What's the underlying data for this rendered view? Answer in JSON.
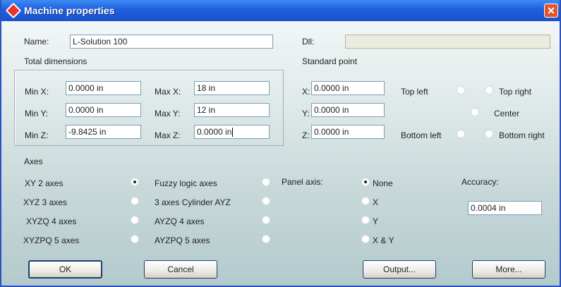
{
  "window": {
    "title": "Machine properties",
    "close_glyph": "✕"
  },
  "name": {
    "label": "Name:",
    "value": "L-Solution 100"
  },
  "dll": {
    "label": "Dll:",
    "value": ""
  },
  "total_dimensions": {
    "title": "Total dimensions",
    "min_x": {
      "label": "Min X:",
      "value": "0.0000 in"
    },
    "max_x": {
      "label": "Max X:",
      "value": "18 in"
    },
    "min_y": {
      "label": "Min Y:",
      "value": "0.0000 in"
    },
    "max_y": {
      "label": "Max Y:",
      "value": "12 in"
    },
    "min_z": {
      "label": "Min Z:",
      "value": "-9.8425 in"
    },
    "max_z": {
      "label": "Max Z:",
      "value": "0.0000 in"
    }
  },
  "standard_point": {
    "title": "Standard point",
    "x": {
      "label": "X:",
      "value": "0.0000 in"
    },
    "y": {
      "label": "Y:",
      "value": "0.0000 in"
    },
    "z": {
      "label": "Z:",
      "value": "0.0000 in"
    },
    "top_left": "Top left",
    "top_right": "Top right",
    "center": "Center",
    "bottom_left": "Bottom left",
    "bottom_right": "Bottom right"
  },
  "axes": {
    "title": "Axes",
    "xy2": "XY 2 axes",
    "xyz3": "XYZ 3 axes",
    "xyzq4": "XYZQ 4 axes",
    "xyzpq5": "XYZPQ 5 axes",
    "fuzzy": "Fuzzy logic axes",
    "cyl": "3 axes Cylinder AYZ",
    "ayzq4": "AYZQ 4 axes",
    "ayzpq5": "AYZPQ 5 axes",
    "selected": "XY 2 axes"
  },
  "panel_axis": {
    "label": "Panel axis:",
    "none": "None",
    "x": "X",
    "y": "Y",
    "xy": "X & Y",
    "selected": "None"
  },
  "accuracy": {
    "label": "Accuracy:",
    "value": "0.0004 in"
  },
  "buttons": {
    "ok": "OK",
    "cancel": "Cancel",
    "output": "Output...",
    "more": "More..."
  }
}
